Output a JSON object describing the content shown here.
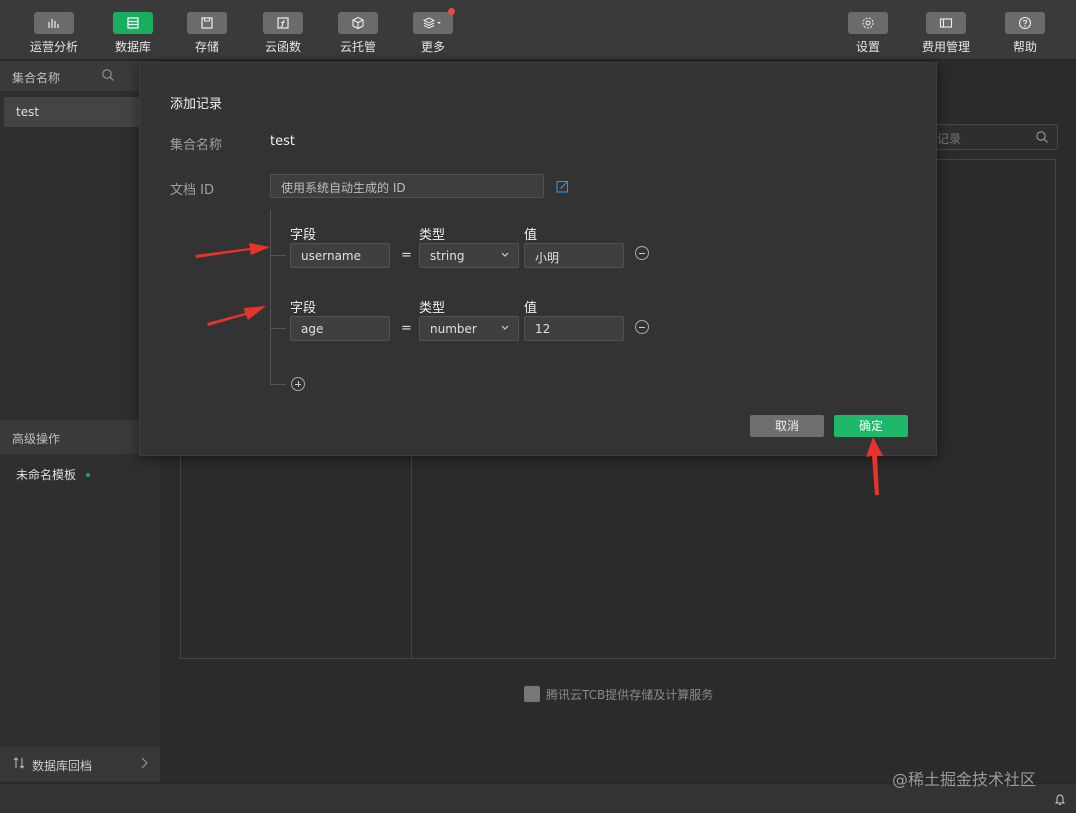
{
  "toolbar": {
    "items": [
      {
        "label": "运营分析",
        "icon": "bar-chart-icon"
      },
      {
        "label": "数据库",
        "icon": "database-icon"
      },
      {
        "label": "存储",
        "icon": "save-icon"
      },
      {
        "label": "云函数",
        "icon": "function-icon"
      },
      {
        "label": "云托管",
        "icon": "cube-icon"
      },
      {
        "label": "更多",
        "icon": "layers-icon"
      }
    ],
    "right_items": [
      {
        "label": "设置",
        "icon": "gear-icon"
      },
      {
        "label": "费用管理",
        "icon": "billing-icon"
      },
      {
        "label": "帮助",
        "icon": "help-icon"
      }
    ]
  },
  "sidebar": {
    "header": "集合名称",
    "collections": [
      "test"
    ],
    "advanced_header": "高级操作",
    "template": "未命名模板",
    "backup": "数据库回档"
  },
  "main": {
    "search_placeholder": "记录",
    "footer_note": "腾讯云TCB提供存储及计算服务"
  },
  "dialog": {
    "title": "添加记录",
    "collection_label": "集合名称",
    "collection_value": "test",
    "docid_label": "文档 ID",
    "docid_placeholder": "使用系统自动生成的 ID",
    "col_field": "字段",
    "col_type": "类型",
    "col_value": "值",
    "fields": [
      {
        "name": "username",
        "type": "string",
        "value": "小明"
      },
      {
        "name": "age",
        "type": "number",
        "value": "12"
      }
    ],
    "cancel": "取消",
    "confirm": "确定"
  },
  "watermark": "@稀土掘金技术社区",
  "colors": {
    "accent": "#1aad5f",
    "annotation": "#e8332a"
  }
}
